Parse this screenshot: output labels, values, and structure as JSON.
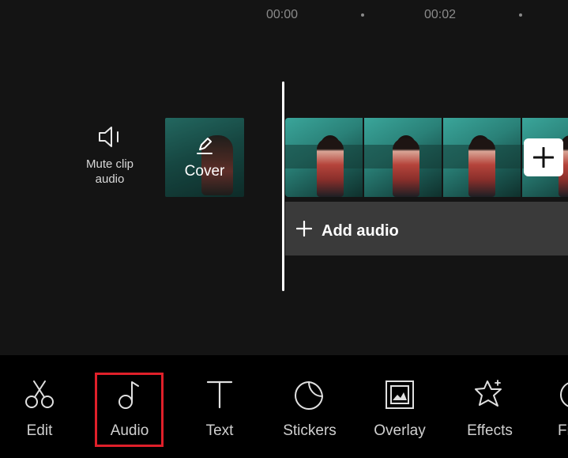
{
  "ruler": {
    "times": [
      "00:00",
      "00:02"
    ]
  },
  "mute_clip": {
    "label_line1": "Mute clip",
    "label_line2": "audio",
    "icon": "speaker-icon"
  },
  "cover": {
    "label": "Cover",
    "icon": "edit-pencil-icon"
  },
  "add_clip": {
    "icon": "plus-icon"
  },
  "audio_track": {
    "label": "Add audio",
    "icon": "plus-icon"
  },
  "toolbar": {
    "items": [
      {
        "label": "Edit",
        "icon": "scissors-icon"
      },
      {
        "label": "Audio",
        "icon": "music-note-icon",
        "selected": true
      },
      {
        "label": "Text",
        "icon": "text-icon"
      },
      {
        "label": "Stickers",
        "icon": "sticker-icon"
      },
      {
        "label": "Overlay",
        "icon": "overlay-icon"
      },
      {
        "label": "Effects",
        "icon": "effects-star-icon"
      },
      {
        "label": "Fi",
        "icon": "filter-icon"
      }
    ]
  },
  "colors": {
    "background": "#141414",
    "toolbar": "#000000",
    "highlight": "#e0202a",
    "audio_track": "#3a3a3a"
  }
}
